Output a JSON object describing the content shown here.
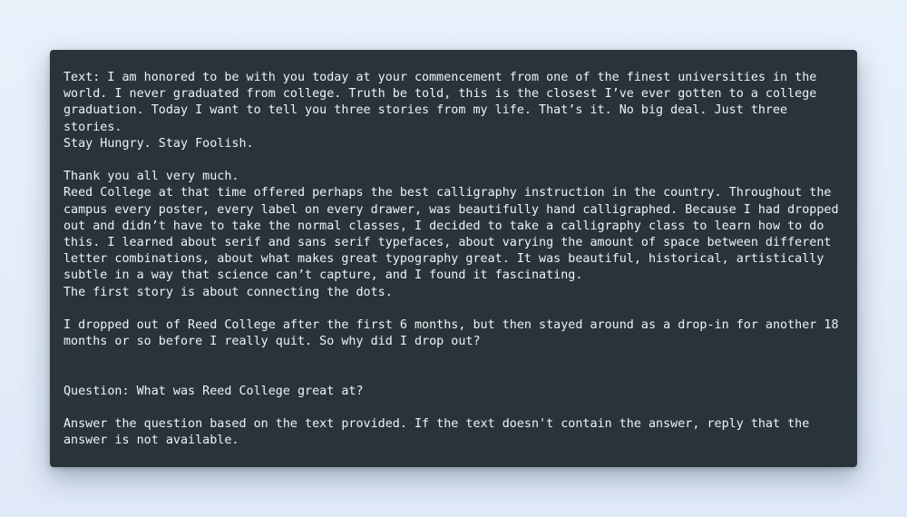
{
  "prompt": {
    "text_block": {
      "para1": "Text: I am honored to be with you today at your commencement from one of the finest universities in the world. I never graduated from college. Truth be told, this is the closest I’ve ever gotten to a college graduation. Today I want to tell you three stories from my life. That’s it. No big deal. Just three stories.",
      "para2": "Stay Hungry. Stay Foolish.",
      "para3": "Thank you all very much.",
      "para4": "Reed College at that time offered perhaps the best calligraphy instruction in the country. Throughout the campus every poster, every label on every drawer, was beautifully hand calligraphed. Because I had dropped out and didn’t have to take the normal classes, I decided to take a calligraphy class to learn how to do this. I learned about serif and sans serif typefaces, about varying the amount of space between different letter combinations, about what makes great typography great. It was beautiful, historical, artistically subtle in a way that science can’t capture, and I found it fascinating.",
      "para5": "The first story is about connecting the dots.",
      "para6": "I dropped out of Reed College after the first 6 months, but then stayed around as a drop-in for another 18 months or so before I really quit. So why did I drop out?"
    },
    "question": "Question: What was Reed College great at?",
    "instruction": "Answer the question based on the text provided. If the text doesn't contain the answer, reply that the answer is not available."
  }
}
